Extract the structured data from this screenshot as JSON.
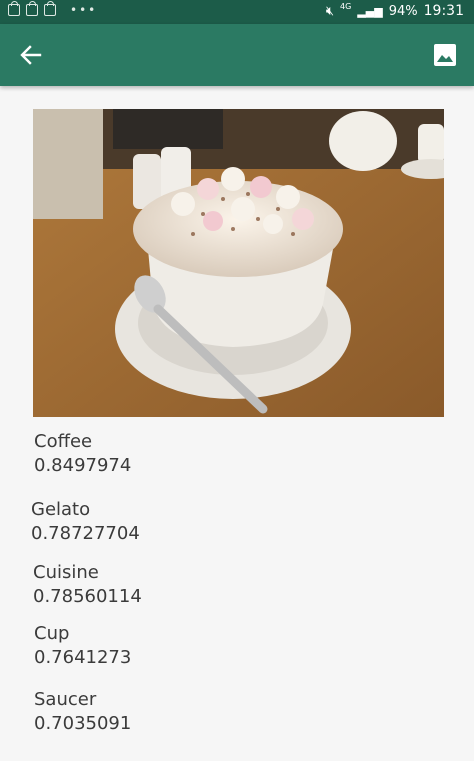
{
  "status_bar": {
    "signal_network": "4G",
    "battery": "94%",
    "time": "19:31",
    "icons": [
      "shopping-bag-icon",
      "shopping-bag-icon",
      "shopping-bag-icon",
      "more-dots-icon",
      "mute-icon",
      "signal-icon",
      "battery-icon"
    ]
  },
  "toolbar": {
    "back_icon": "arrow-back-icon",
    "gallery_icon": "image-icon",
    "color": "#2b7a63"
  },
  "photo": {
    "subject": "photo"
  },
  "results": [
    {
      "label": "Coffee",
      "score": "0.8497974"
    },
    {
      "label": "Gelato",
      "score": "0.78727704"
    },
    {
      "label": "Cuisine",
      "score": "0.78560114"
    },
    {
      "label": "Cup",
      "score": "0.7641273"
    },
    {
      "label": "Saucer",
      "score": "0.7035091"
    }
  ],
  "colors": {
    "status_bar": "#1c5c49",
    "background": "#f6f6f6",
    "text": "#3b3b3b"
  }
}
